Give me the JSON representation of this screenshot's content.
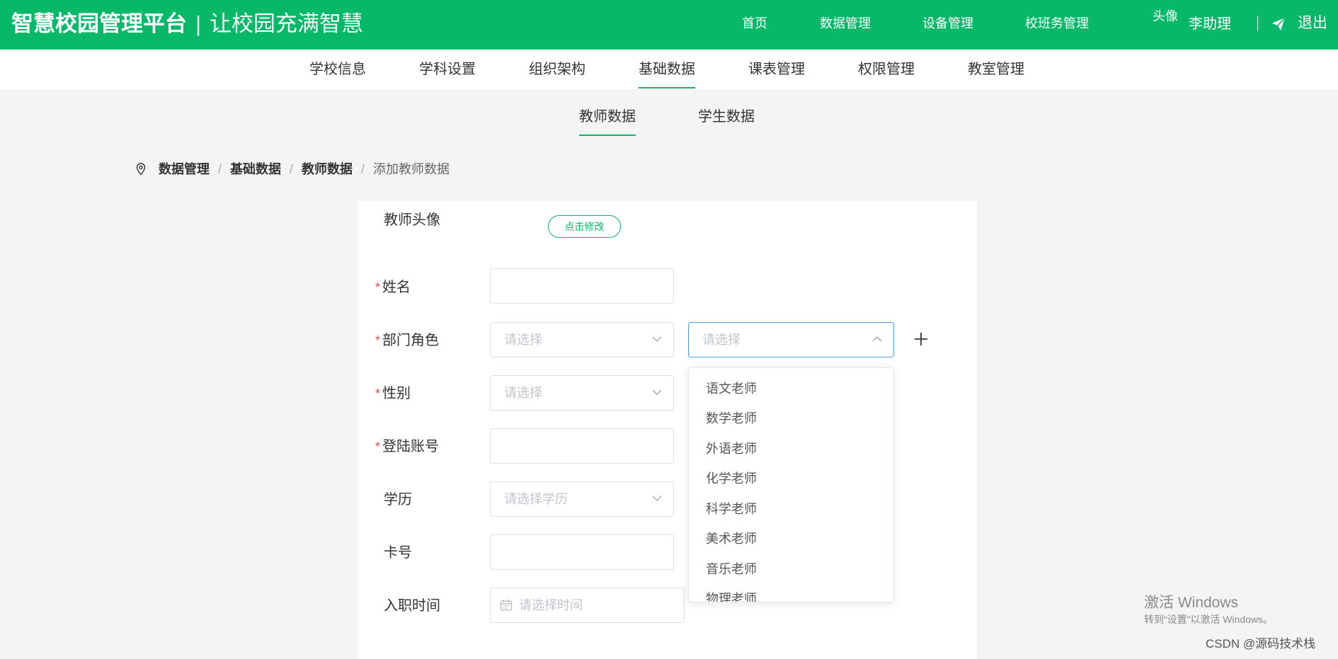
{
  "header": {
    "brand_title": "智慧校园管理平台",
    "brand_sep": "|",
    "brand_slogan": "让校园充满智慧",
    "nav": [
      "首页",
      "数据管理",
      "设备管理",
      "校班务管理"
    ],
    "avatar_alt": "头像",
    "username": "李助理",
    "logout": "退出"
  },
  "subnav": {
    "items": [
      "学校信息",
      "学科设置",
      "组织架构",
      "基础数据",
      "课表管理",
      "权限管理",
      "教室管理"
    ],
    "active_index": 3
  },
  "tabs": {
    "items": [
      "教师数据",
      "学生数据"
    ],
    "active_index": 0
  },
  "breadcrumb": {
    "items": [
      "数据管理",
      "基础数据",
      "教师数据"
    ],
    "separator": "/",
    "current": "添加教师数据"
  },
  "form": {
    "avatar_label": "教师头像",
    "avatar_button": "点击修改",
    "required_mark": "*",
    "name_label": "姓名",
    "name_value": "",
    "dept_role_label": "部门角色",
    "dept_placeholder": "请选择",
    "role_placeholder": "请选择",
    "gender_label": "性别",
    "gender_placeholder": "请选择",
    "account_label": "登陆账号",
    "account_value": "",
    "education_label": "学历",
    "education_placeholder": "请选择学历",
    "card_label": "卡号",
    "card_value": "",
    "hire_label": "入职时间",
    "hire_placeholder": "请选择时间"
  },
  "role_dropdown": {
    "options": [
      "语文老师",
      "数学老师",
      "外语老师",
      "化学老师",
      "科学老师",
      "美术老师",
      "音乐老师",
      "物理老师"
    ]
  },
  "watermark": {
    "title": "激活 Windows",
    "subtitle": "转到“设置”以激活 Windows。",
    "credit": "CSDN @源码技术栈"
  },
  "colors": {
    "brand_green": "#07b868",
    "required_red": "#f04848",
    "focus_blue": "#4d9bf0"
  }
}
